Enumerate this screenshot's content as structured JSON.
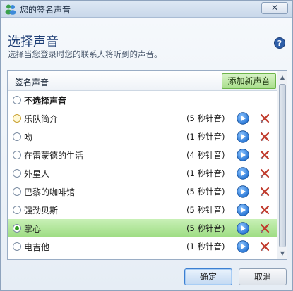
{
  "window": {
    "title": "您的签名声音",
    "close_label": "✕"
  },
  "header": {
    "heading": "选择声音",
    "subtitle": "选择当您登录时您的联系人将听到的声音。"
  },
  "list": {
    "column_header": "签名声音",
    "add_button_label": "添加新声音",
    "selected_index": 7,
    "items": [
      {
        "name": "不选择声音",
        "duration": "",
        "bold": true
      },
      {
        "name": "乐队简介",
        "duration": "(5 秒针音)"
      },
      {
        "name": "吻",
        "duration": "(1 秒针音)"
      },
      {
        "name": "在雷蒙德的生活",
        "duration": "(4 秒针音)"
      },
      {
        "name": "外星人",
        "duration": "(1 秒针音)"
      },
      {
        "name": "巴黎的咖啡馆",
        "duration": "(5 秒针音)"
      },
      {
        "name": "强劲贝斯",
        "duration": "(5 秒针音)"
      },
      {
        "name": "掌心",
        "duration": "(5 秒针音)"
      },
      {
        "name": "电吉他",
        "duration": "(1 秒针音)"
      }
    ]
  },
  "footer": {
    "ok_label": "确定",
    "cancel_label": "取消"
  },
  "colors": {
    "accent": "#1c3d74",
    "selected_row": "#a9df8c",
    "play_button": "#1f6fd1",
    "delete_icon": "#c0392b"
  }
}
